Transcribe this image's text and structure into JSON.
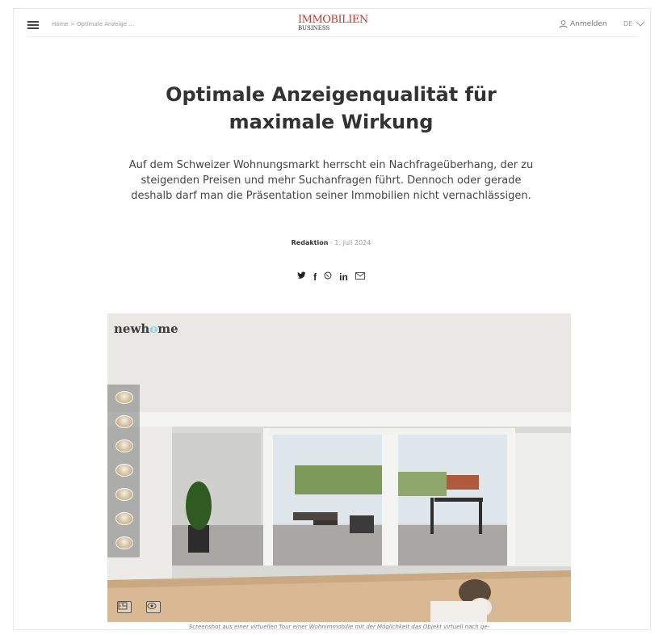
{
  "header": {
    "breadcrumb_home": "Home",
    "breadcrumb_sep": ">",
    "breadcrumb_current": "Optimale Anzeige ...",
    "logo_line1": "IMMOBILIEN",
    "logo_line2": "BUSINESS",
    "login_label": "Anmelden",
    "language": "DE"
  },
  "article": {
    "title": "Optimale Anzeigenqualität für maximale Wirkung",
    "lead": "Auf dem Schweizer Wohnungsmarkt herrscht ein Nachfrageüberhang, der zu steigenden Preisen und mehr Suchanfragen führt. Dennoch oder gerade deshalb darf man die Präsentation seiner Immobilien nicht vernachlässigen.",
    "author": "Redaktion",
    "date_sep": " - ",
    "date": "1. Juli 2024"
  },
  "share": [
    "twitter-icon",
    "facebook-icon",
    "whatsapp-icon",
    "linkedin-icon",
    "mail-icon"
  ],
  "hero": {
    "brand_part1": "newh",
    "brand_o": "o",
    "brand_part2": "me"
  },
  "caption": "Screenshot aus einer virtuellen Tour einer Wohnimmobilie mit der Möglichkeit das Objekt virtuell nach ge-",
  "colors": {
    "logo_red": "#c0392b",
    "text": "#333333",
    "muted": "#999999"
  }
}
